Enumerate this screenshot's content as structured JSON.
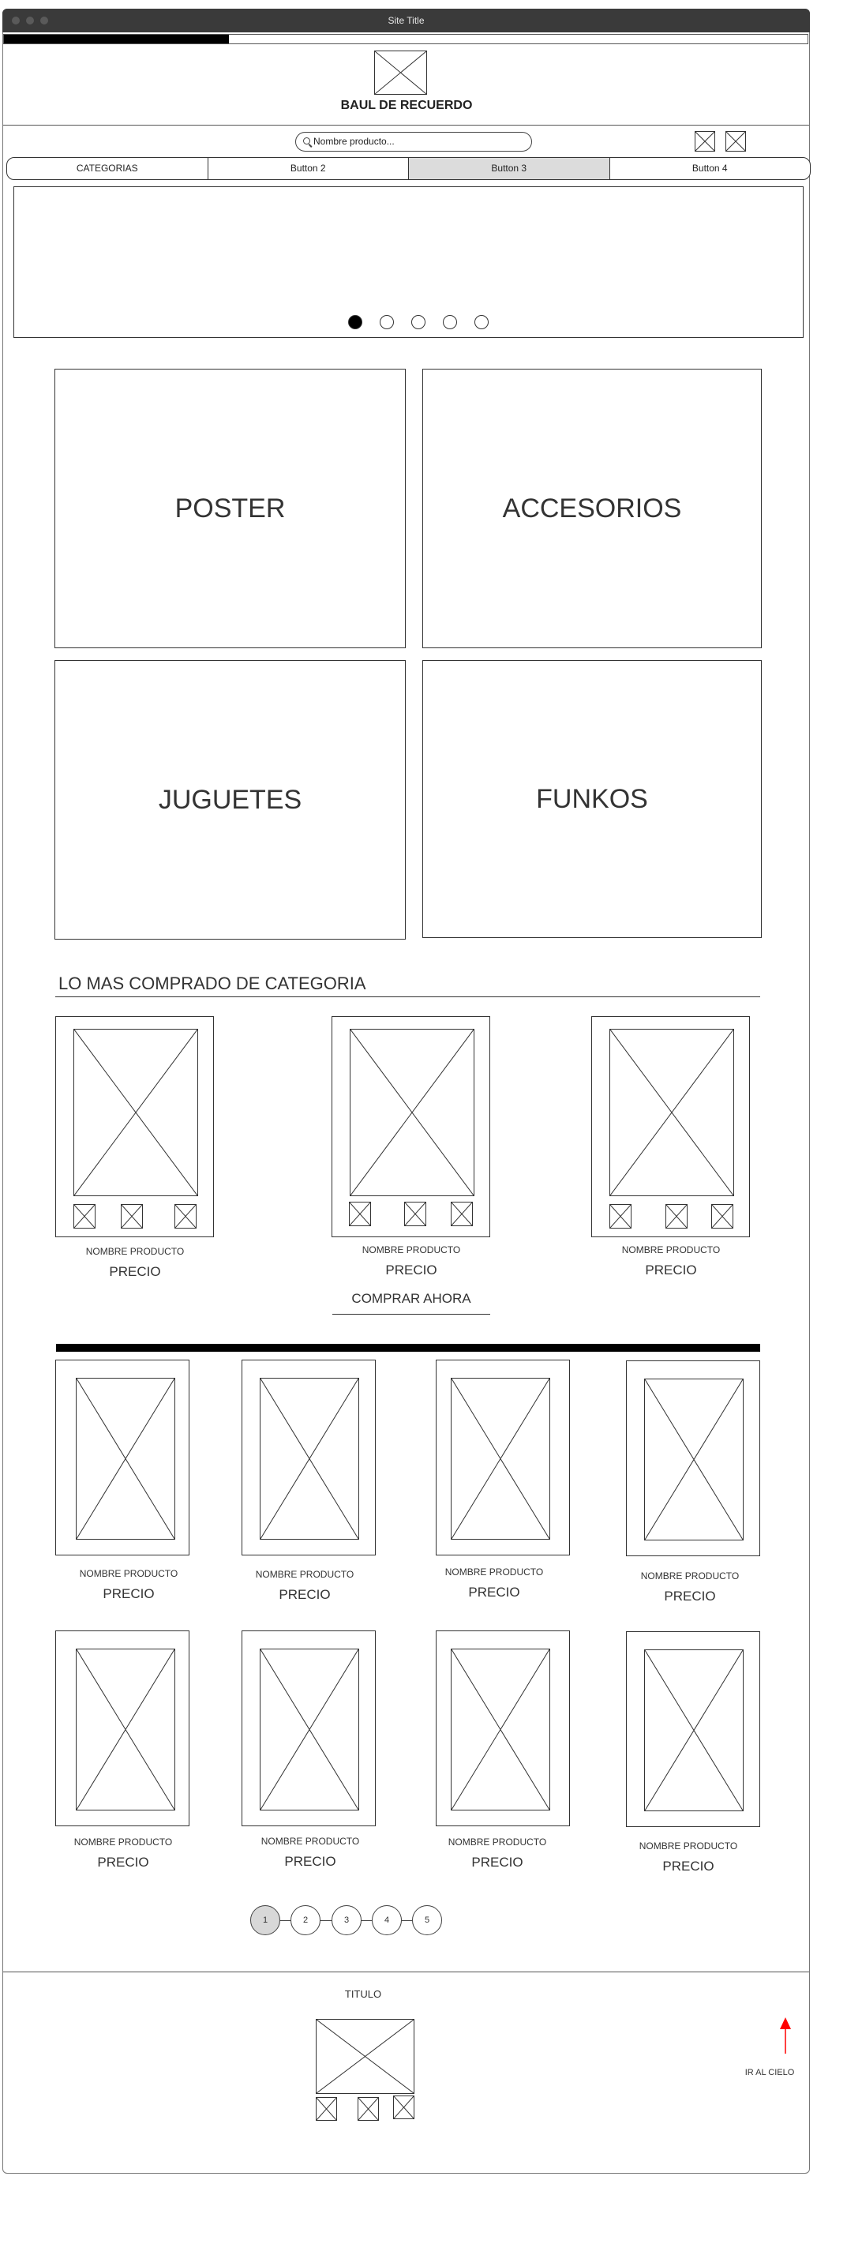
{
  "window": {
    "title": "Site Title"
  },
  "progress": {
    "percent": 28
  },
  "header": {
    "brand": "BAUL DE RECUERDO"
  },
  "search": {
    "placeholder": "Nombre producto..."
  },
  "nav": {
    "buttons": [
      "CATEGORIAS",
      "Button 2",
      "Button 3",
      "Button 4"
    ],
    "active_index": 2
  },
  "carousel": {
    "slide_count": 5,
    "active_index": 0
  },
  "categories": [
    "POSTER",
    "ACCESORIOS",
    "JUGUETES",
    "FUNKOS"
  ],
  "best_sellers": {
    "title": "LO MAS COMPRADO DE CATEGORIA",
    "items": [
      {
        "name": "NOMBRE PRODUCTO",
        "price": "PRECIO"
      },
      {
        "name": "NOMBRE PRODUCTO",
        "price": "PRECIO"
      },
      {
        "name": "NOMBRE PRODUCTO",
        "price": "PRECIO"
      }
    ],
    "cta": "COMPRAR AHORA"
  },
  "products": [
    {
      "name": "NOMBRE PRODUCTO",
      "price": "PRECIO"
    },
    {
      "name": "NOMBRE PRODUCTO",
      "price": "PRECIO"
    },
    {
      "name": "NOMBRE PRODUCTO",
      "price": "PRECIO"
    },
    {
      "name": "NOMBRE PRODUCTO",
      "price": "PRECIO"
    },
    {
      "name": "NOMBRE PRODUCTO",
      "price": "PRECIO"
    },
    {
      "name": "NOMBRE PRODUCTO",
      "price": "PRECIO"
    },
    {
      "name": "NOMBRE PRODUCTO",
      "price": "PRECIO"
    },
    {
      "name": "NOMBRE PRODUCTO",
      "price": "PRECIO"
    }
  ],
  "pagination": {
    "pages": [
      "1",
      "2",
      "3",
      "4",
      "5"
    ],
    "active_index": 0
  },
  "footer": {
    "title": "TITULO",
    "to_top": "IR AL CIELO"
  },
  "colors": {
    "accent": "#ff0000",
    "titlebar": "#3a3a3a",
    "active_button": "#dcdcdc"
  },
  "icons": {
    "placeholder": "image-placeholder-icon",
    "to_top": "arrow-up-icon",
    "search": "search-icon"
  }
}
